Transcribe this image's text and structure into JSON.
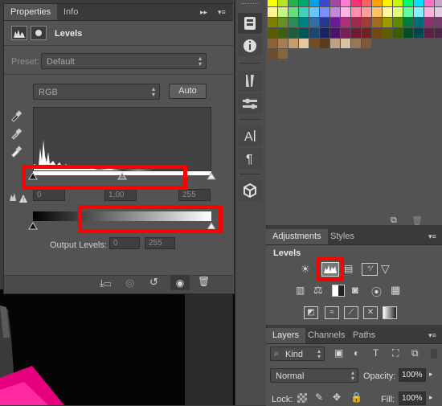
{
  "colors": {
    "panel": "#535353",
    "dark": "#3a3a3a",
    "highlight_red": "#ff0000",
    "swatch_rows": [
      [
        "#ffff00",
        "#b5e61d",
        "#22b14c",
        "#00a86b",
        "#00a2e8",
        "#3f48cc",
        "#a349a4",
        "#ff7bd5",
        "#ff2d72",
        "#ff5e5e",
        "#ff9f00",
        "#fff200",
        "#c0ff00",
        "#00ff6a",
        "#00e5ff",
        "#ff6ec7",
        "#c8a2c8"
      ],
      [
        "#fff68f",
        "#c3f584",
        "#66e07c",
        "#41d0b7",
        "#66c7ff",
        "#7f8cff",
        "#c488d9",
        "#ffb3e6",
        "#ff8fb1",
        "#ff9d9d",
        "#ffc266",
        "#fff799",
        "#e1ff7a",
        "#5cff9c",
        "#85f1ff",
        "#ffb1de",
        "#e4c8e4"
      ],
      [
        "#808000",
        "#6b8e23",
        "#2e8b57",
        "#008080",
        "#2f6fa8",
        "#283593",
        "#6a1b9a",
        "#b0307a",
        "#a0284b",
        "#a33a3a",
        "#a06b1a",
        "#9c9c00",
        "#5c8a00",
        "#007a3d",
        "#006b7a",
        "#8e2f6e",
        "#7a3a6a"
      ],
      [
        "#5a5a00",
        "#3f5f10",
        "#1f5c3a",
        "#005555",
        "#1a4670",
        "#1b2366",
        "#4a1269",
        "#7a1f55",
        "#6e1a33",
        "#6e2424",
        "#6e4a12",
        "#5e5e00",
        "#3d5c00",
        "#004f28",
        "#004650",
        "#5e1f49",
        "#4f2646"
      ],
      [
        "#8c6239",
        "#a67c52",
        "#c69c6d",
        "#e6c8a0",
        "#734c24",
        "#5c3a1b",
        "#c0a080",
        "#d9c1a3",
        "#9b7653",
        "#7d5a3c",
        "#ffffff",
        "#ffffff",
        "#ffffff",
        "#ffffff",
        "#ffffff",
        "#ffffff",
        "#ffffff"
      ],
      [
        "#6d4c2f",
        "#8a633f",
        "#ffffff",
        "#ffffff",
        "#ffffff",
        "#ffffff",
        "#ffffff",
        "#ffffff",
        "#ffffff",
        "#ffffff",
        "#ffffff",
        "#ffffff",
        "#ffffff",
        "#ffffff",
        "#ffffff",
        "#ffffff",
        "#ffffff"
      ]
    ]
  },
  "properties": {
    "tab_properties": "Properties",
    "tab_info": "Info",
    "panel_menu_icon": "panel-menu-icon",
    "title": "Levels",
    "preset_label": "Preset:",
    "preset_value": "Default",
    "channel_value": "RGB",
    "auto_label": "Auto",
    "input_black": "0",
    "input_gamma": "1,00",
    "input_white": "255",
    "output_label": "Output Levels:",
    "output_black": "0",
    "output_white": "255"
  },
  "adjustments": {
    "tab_adjustments": "Adjustments",
    "tab_styles": "Styles",
    "section_title": "Levels"
  },
  "layers": {
    "tab_layers": "Layers",
    "tab_channels": "Channels",
    "tab_paths": "Paths",
    "filter_kind": "Kind",
    "blend_mode": "Normal",
    "opacity_label": "Opacity:",
    "opacity_value": "100%",
    "lock_label": "Lock:",
    "fill_label": "Fill:",
    "fill_value": "100%"
  }
}
